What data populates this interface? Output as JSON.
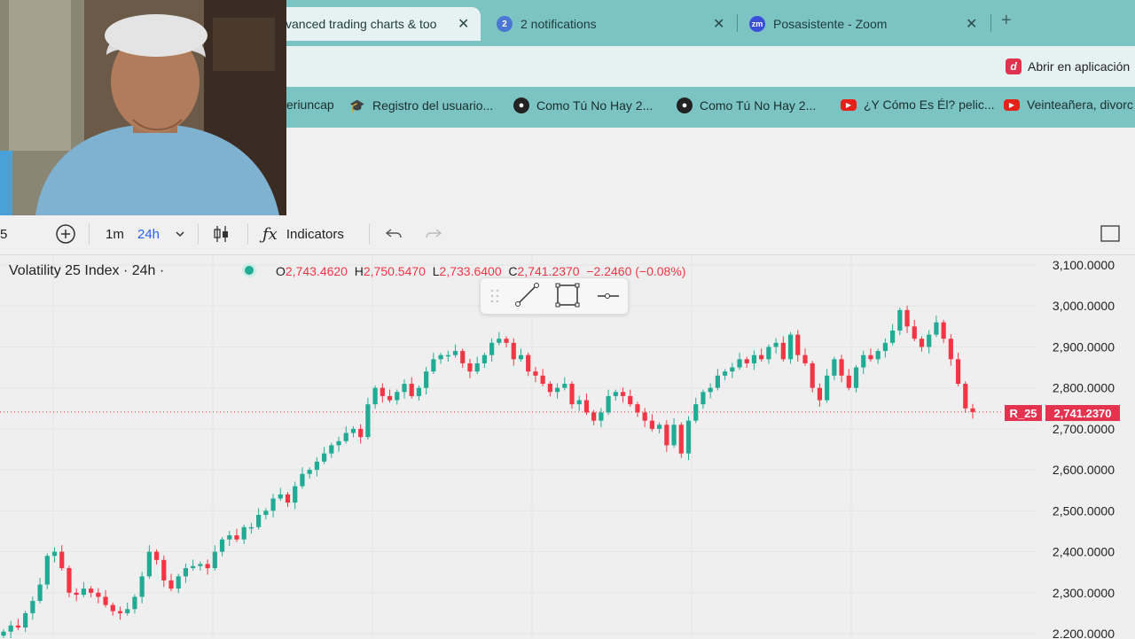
{
  "browser": {
    "tabs": [
      {
        "title": "vanced trading charts & too",
        "close": "✕"
      },
      {
        "title": "2 notifications",
        "badge": "2",
        "close": "✕"
      },
      {
        "title": "Posasistente - Zoom",
        "badge": "zm",
        "close": "✕"
      }
    ],
    "new_tab": "+",
    "open_in_app": {
      "icon": "d",
      "label": "Abrir en aplicación"
    },
    "bookmarks": [
      {
        "label": "eriuncap"
      },
      {
        "label": "Registro del usuario..."
      },
      {
        "label": "Como Tú No Hay 2..."
      },
      {
        "label": "Como Tú No Hay 2..."
      },
      {
        "label": "¿Y Cómo Es Él? pelic..."
      },
      {
        "label": "Veinteañera, divorc"
      }
    ]
  },
  "toolbar": {
    "symbol_fragment": "5",
    "add_symbol": "+",
    "intervals": [
      "1m",
      "24h"
    ],
    "indicators_label": "Indicators"
  },
  "chart": {
    "title": "Volatility 25 Index · 24h ·",
    "ohlc": {
      "o_key": "O",
      "o": "2,743.4620",
      "h_key": "H",
      "h": "2,750.5470",
      "l_key": "L",
      "l": "2,733.6400",
      "c_key": "C",
      "c": "2,741.2370",
      "change": "−2.2460 (−0.08%)"
    },
    "symbol_tag": "R_25",
    "last_price_tag": "2,741.2370",
    "colors": {
      "up": "#22ab94",
      "down": "#f23645"
    }
  },
  "chart_data": {
    "type": "candlestick",
    "title": "Volatility 25 Index · 24h ·",
    "y_ticks": [
      "3,100.0000",
      "3,000.0000",
      "2,900.0000",
      "2,800.0000",
      "2,700.0000",
      "2,600.0000",
      "2,500.0000",
      "2,400.0000",
      "2,300.0000",
      "2,200.0000"
    ],
    "ylim": [
      2200,
      3100
    ],
    "last_price": 2741.237,
    "series_close": [
      2205,
      2220,
      2215,
      2250,
      2280,
      2320,
      2390,
      2400,
      2360,
      2300,
      2295,
      2310,
      2300,
      2290,
      2270,
      2255,
      2250,
      2260,
      2290,
      2340,
      2400,
      2380,
      2330,
      2310,
      2340,
      2360,
      2365,
      2370,
      2360,
      2400,
      2430,
      2440,
      2430,
      2460,
      2460,
      2490,
      2500,
      2530,
      2540,
      2520,
      2560,
      2590,
      2600,
      2620,
      2640,
      2660,
      2670,
      2690,
      2700,
      2680,
      2760,
      2800,
      2780,
      2770,
      2790,
      2810,
      2780,
      2800,
      2840,
      2870,
      2880,
      2880,
      2890,
      2860,
      2840,
      2860,
      2880,
      2910,
      2920,
      2910,
      2870,
      2880,
      2840,
      2830,
      2810,
      2790,
      2800,
      2810,
      2760,
      2770,
      2740,
      2720,
      2740,
      2780,
      2790,
      2780,
      2760,
      2740,
      2720,
      2700,
      2710,
      2660,
      2710,
      2640,
      2720,
      2760,
      2790,
      2800,
      2830,
      2840,
      2850,
      2870,
      2860,
      2880,
      2870,
      2900,
      2910,
      2870,
      2930,
      2880,
      2860,
      2800,
      2770,
      2830,
      2870,
      2830,
      2800,
      2850,
      2880,
      2870,
      2890,
      2910,
      2940,
      2990,
      2950,
      2920,
      2900,
      2930,
      2960,
      2920,
      2870,
      2810,
      2750,
      2741
    ]
  }
}
